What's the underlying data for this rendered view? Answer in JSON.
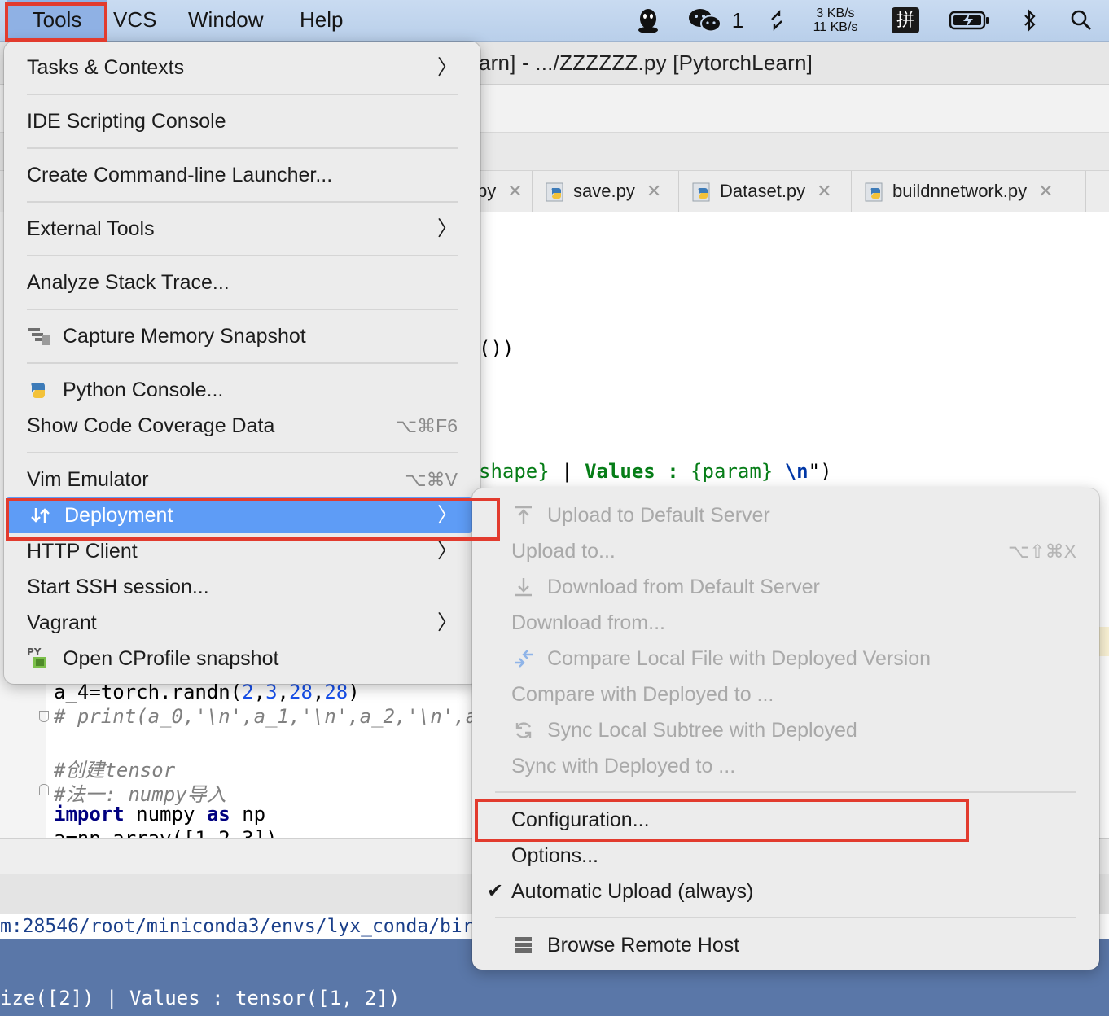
{
  "menubar": {
    "items": [
      {
        "key": "tools",
        "label": "Tools"
      },
      {
        "key": "vcs",
        "label": "VCS"
      },
      {
        "key": "window",
        "label": "Window"
      },
      {
        "key": "help",
        "label": "Help"
      }
    ],
    "status": {
      "wechat_count": "1",
      "net_up": "3 KB/s",
      "net_down": "11 KB/s",
      "input_method": "拼",
      "icons": [
        "qq-icon",
        "wechat-icon",
        "sync-icon",
        "battery-icon",
        "bluetooth-icon",
        "spotlight-icon"
      ]
    }
  },
  "window": {
    "title_fragment": "arn] - .../ZZZZZZ.py [PytorchLearn]"
  },
  "tabs": [
    {
      "label": "py",
      "partial": true
    },
    {
      "label": "save.py"
    },
    {
      "label": "Dataset.py"
    },
    {
      "label": "buildnnetwork.py"
    }
  ],
  "code": {
    "line_a": "())",
    "line_b_shape": "shape}",
    "line_b_bar": " | ",
    "line_b_values": "Values : ",
    "line_b_param": "{param}",
    "line_b_space": " ",
    "line_b_newline": "\\n",
    "line_b_quote": "\")",
    "l1_pre": "a_4=torch.randn(",
    "l1_n1": "2",
    "l1_n2": "3",
    "l1_n3": "28",
    "l1_n4": "28",
    "l1_post": ")",
    "l2": "# print(a_0,'\\n',a_1,'\\n',a_2,'\\n',a_",
    "l3": "#创建tensor",
    "l4": "#法一: numpy导入",
    "l5_import": "import",
    "l5_mid": " numpy ",
    "l5_as": "as",
    "l5_np": " np",
    "l6": "a=np.array([1,2,3])"
  },
  "terminal": {
    "path": "m:28546/root/miniconda3/envs/lyx_conda/bir",
    "console": "ize([2]) | Values : tensor([1, 2])"
  },
  "tools_menu": {
    "items": [
      {
        "label": "Tasks & Contexts",
        "submenu": true
      },
      {
        "label": "IDE Scripting Console"
      },
      {
        "label": "Create Command-line Launcher..."
      },
      {
        "label": "External Tools",
        "submenu": true
      },
      {
        "label": "Analyze Stack Trace..."
      },
      {
        "label": "Capture Memory Snapshot",
        "icon": "memory-snapshot-icon"
      },
      {
        "label": "Python Console...",
        "icon": "python-icon"
      },
      {
        "label": "Show Code Coverage Data",
        "shortcut": "⌥⌘F6"
      },
      {
        "label": "Vim Emulator",
        "shortcut": "⌥⌘V"
      },
      {
        "label": "Deployment",
        "icon": "deployment-icon",
        "submenu": true,
        "highlighted": true
      },
      {
        "label": "HTTP Client",
        "submenu": true
      },
      {
        "label": "Start SSH session..."
      },
      {
        "label": "Vagrant",
        "submenu": true
      },
      {
        "label": "Open CProfile snapshot",
        "icon": "cprofile-icon"
      }
    ]
  },
  "deployment_menu": {
    "items": [
      {
        "label": "Upload to Default Server",
        "icon": "upload-icon",
        "disabled": true
      },
      {
        "label": "Upload to...",
        "shortcut": "⌥⇧⌘X",
        "disabled": true
      },
      {
        "label": "Download from Default Server",
        "icon": "download-icon",
        "disabled": true
      },
      {
        "label": "Download from...",
        "disabled": true
      },
      {
        "label": "Compare Local File with Deployed Version",
        "icon": "compare-icon",
        "disabled": true
      },
      {
        "label": "Compare with Deployed to ...",
        "disabled": true
      },
      {
        "label": "Sync Local Subtree with Deployed",
        "icon": "sync-icon",
        "disabled": true
      },
      {
        "label": "Sync with Deployed to ...",
        "disabled": true
      },
      {
        "label": "Configuration..."
      },
      {
        "label": "Options..."
      },
      {
        "label": "Automatic Upload (always)",
        "checked": true
      },
      {
        "label": "Browse Remote Host",
        "icon": "remote-host-icon"
      }
    ]
  },
  "colors": {
    "highlight": "#5e9cf6",
    "annotation": "#e23b2e",
    "menu_bg": "#ececec",
    "menubar_bg": "#c9dbf1"
  }
}
